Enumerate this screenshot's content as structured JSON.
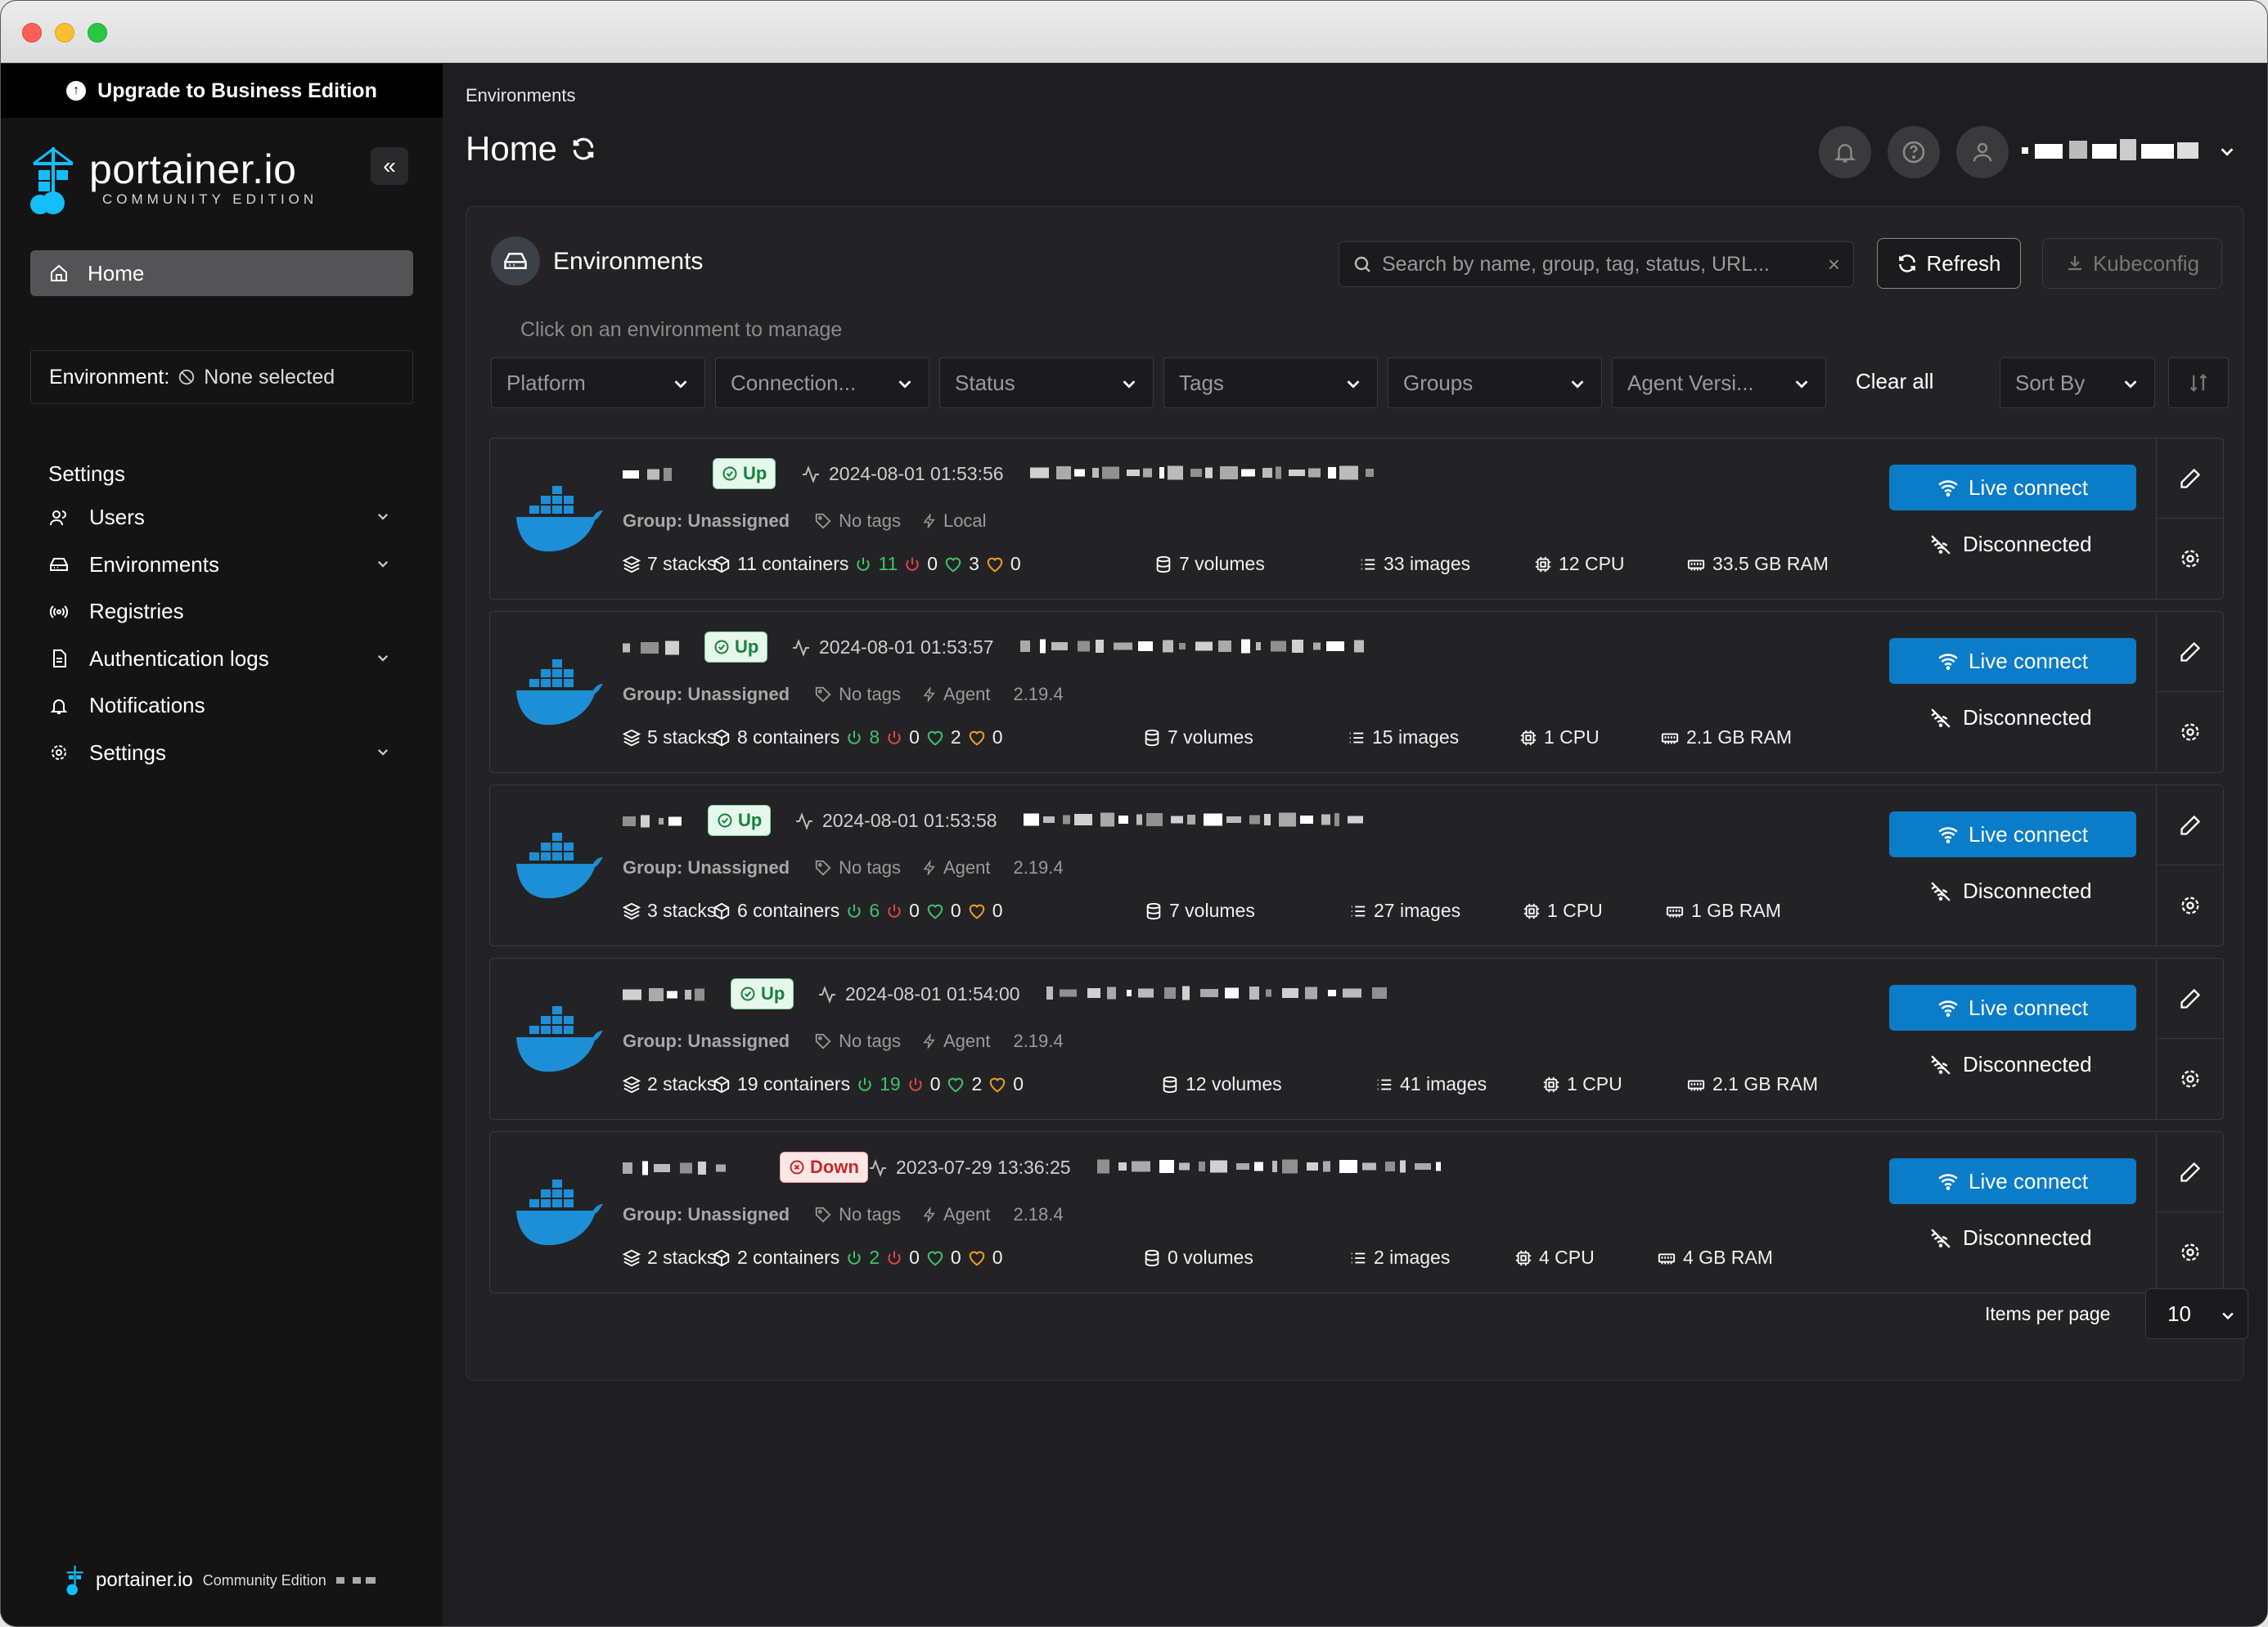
{
  "sidebar": {
    "upgrade_label": "Upgrade to Business Edition",
    "logo_wordmark": "portainer.io",
    "logo_edition": "COMMUNITY EDITION",
    "home_label": "Home",
    "environment_label": "Environment:",
    "environment_value": "None selected",
    "settings_header": "Settings",
    "items": [
      {
        "label": "Users",
        "icon": "users-icon",
        "expandable": true
      },
      {
        "label": "Environments",
        "icon": "environments-icon",
        "expandable": true
      },
      {
        "label": "Registries",
        "icon": "radio-icon",
        "expandable": false
      },
      {
        "label": "Authentication logs",
        "icon": "file-text-icon",
        "expandable": true
      },
      {
        "label": "Notifications",
        "icon": "bell-icon",
        "expandable": false
      },
      {
        "label": "Settings",
        "icon": "gear-icon",
        "expandable": true
      }
    ],
    "footer_wordmark": "portainer.io",
    "footer_edition": "Community Edition"
  },
  "header": {
    "breadcrumb": "Environments",
    "title": "Home"
  },
  "panel": {
    "title": "Environments",
    "search_placeholder": "Search by name, group, tag, status, URL...",
    "refresh_label": "Refresh",
    "kubeconfig_label": "Kubeconfig",
    "hint": "Click on an environment to manage",
    "filters": [
      "Platform",
      "Connection...",
      "Status",
      "Tags",
      "Groups",
      "Agent Versi..."
    ],
    "clear_all": "Clear all",
    "sort_by": "Sort By",
    "items_per_page_label": "Items per page",
    "items_per_page_value": "10"
  },
  "environments": [
    {
      "status": "Up",
      "heartbeat": "2024-08-01 01:53:56",
      "group": "Group: Unassigned",
      "tags": "No tags",
      "type": "Local",
      "version": "",
      "stacks": "7 stacks",
      "containers": "11 containers",
      "running": "11",
      "stopped": "0",
      "healthy": "3",
      "unhealthy": "0",
      "volumes": "7 volumes",
      "images": "33 images",
      "cpu": "12 CPU",
      "ram": "33.5 GB RAM",
      "live_connect": "Live connect",
      "connection": "Disconnected"
    },
    {
      "status": "Up",
      "heartbeat": "2024-08-01 01:53:57",
      "group": "Group: Unassigned",
      "tags": "No tags",
      "type": "Agent",
      "version": "2.19.4",
      "stacks": "5 stacks",
      "containers": "8 containers",
      "running": "8",
      "stopped": "0",
      "healthy": "2",
      "unhealthy": "0",
      "volumes": "7 volumes",
      "images": "15 images",
      "cpu": "1 CPU",
      "ram": "2.1 GB RAM",
      "live_connect": "Live connect",
      "connection": "Disconnected"
    },
    {
      "status": "Up",
      "heartbeat": "2024-08-01 01:53:58",
      "group": "Group: Unassigned",
      "tags": "No tags",
      "type": "Agent",
      "version": "2.19.4",
      "stacks": "3 stacks",
      "containers": "6 containers",
      "running": "6",
      "stopped": "0",
      "healthy": "0",
      "unhealthy": "0",
      "volumes": "7 volumes",
      "images": "27 images",
      "cpu": "1 CPU",
      "ram": "1 GB RAM",
      "live_connect": "Live connect",
      "connection": "Disconnected"
    },
    {
      "status": "Up",
      "heartbeat": "2024-08-01 01:54:00",
      "group": "Group: Unassigned",
      "tags": "No tags",
      "type": "Agent",
      "version": "2.19.4",
      "stacks": "2 stacks",
      "containers": "19 containers",
      "running": "19",
      "stopped": "0",
      "healthy": "2",
      "unhealthy": "0",
      "volumes": "12 volumes",
      "images": "41 images",
      "cpu": "1 CPU",
      "ram": "2.1 GB RAM",
      "live_connect": "Live connect",
      "connection": "Disconnected"
    },
    {
      "status": "Down",
      "heartbeat": "2023-07-29 13:36:25",
      "group": "Group: Unassigned",
      "tags": "No tags",
      "type": "Agent",
      "version": "2.18.4",
      "stacks": "2 stacks",
      "containers": "2 containers",
      "running": "2",
      "stopped": "0",
      "healthy": "0",
      "unhealthy": "0",
      "volumes": "0 volumes",
      "images": "2 images",
      "cpu": "4 CPU",
      "ram": "4 GB RAM",
      "live_connect": "Live connect",
      "connection": "Disconnected"
    }
  ],
  "colors": {
    "accent": "#0b7cc8",
    "up": "#17823d",
    "down": "#c62828",
    "running": "#3dc46a",
    "stopped": "#e04646",
    "unhealthy": "#f39c1e"
  }
}
